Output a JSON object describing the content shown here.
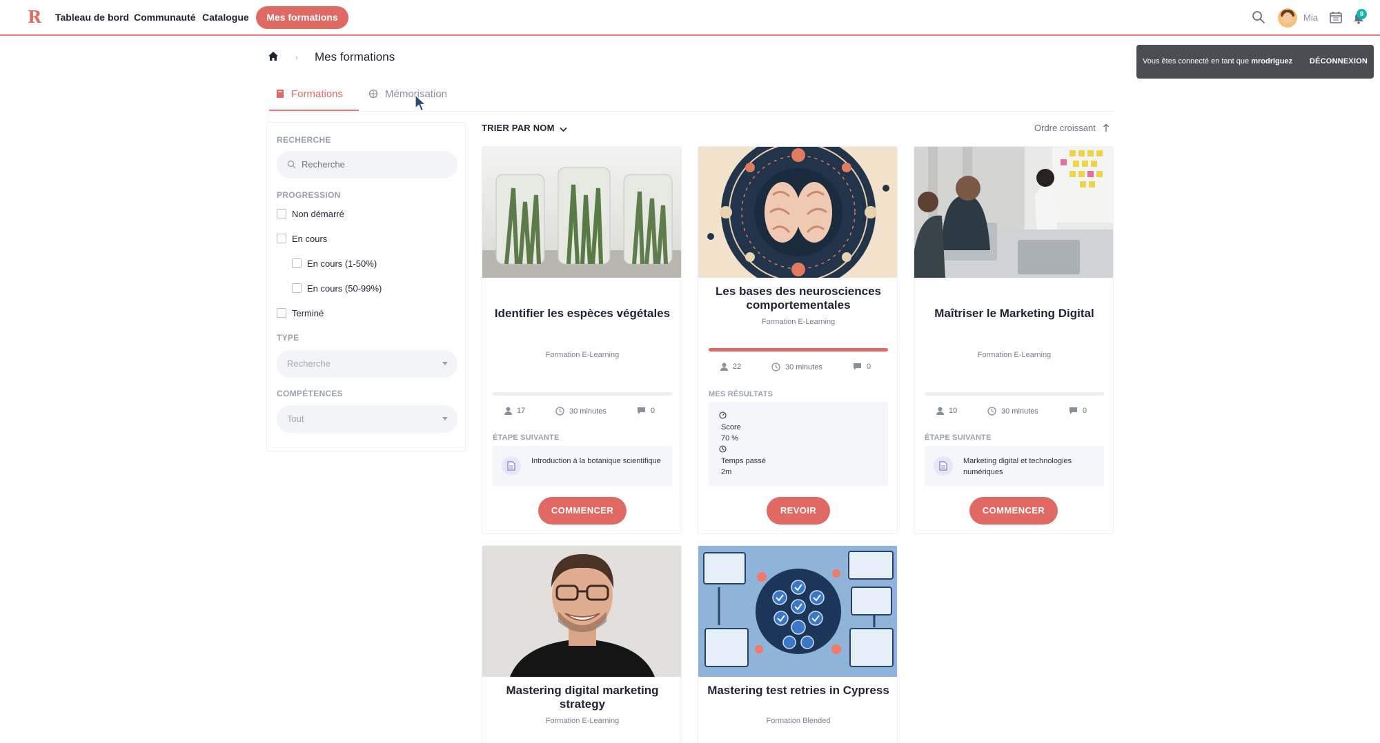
{
  "nav": {
    "logo": "R",
    "links": [
      "Tableau de bord",
      "Communauté",
      "Catalogue"
    ],
    "active": "Mes formations",
    "user_name": "Mia",
    "notification_count": "8",
    "icons": [
      "search-icon",
      "calendar-icon",
      "bell-icon"
    ]
  },
  "toast": {
    "prefix": "Vous êtes connecté en tant que",
    "username": "mrodriguez",
    "action": "DÉCONNEXION"
  },
  "breadcrumb": {
    "separator": "›",
    "title": "Mes formations"
  },
  "tabs": [
    {
      "label": "Formations",
      "active": true
    },
    {
      "label": "Mémorisation",
      "active": false
    }
  ],
  "filters": {
    "search_label": "RECHERCHE",
    "search_placeholder": "Recherche",
    "progress_label": "PROGRESSION",
    "progress_options": [
      "Non démarré",
      "En cours",
      "En cours (1-50%)",
      "En cours (50-99%)",
      "Terminé"
    ],
    "type_label": "TYPE",
    "type_value": "Recherche",
    "skills_label": "COMPÉTENCES",
    "skills_value": "Tout"
  },
  "sort": {
    "by": "TRIER PAR NOM",
    "order": "Ordre croissant"
  },
  "cards": [
    {
      "title": "Identifier les espèces végétales",
      "type": "Formation E-Learning",
      "progress": 0,
      "learners": "17",
      "duration": "30 minutes",
      "comments": "0",
      "next_label": "ÉTAPE SUIVANTE",
      "next_step": "Introduction à la botanique scientifique",
      "button": "COMMENCER"
    },
    {
      "title": "Les bases des neurosciences comportementales",
      "type": "Formation E-Learning",
      "progress": 100,
      "learners": "22",
      "duration": "30 minutes",
      "comments": "0",
      "results_label": "MES RÉSULTATS",
      "score_label": "Score",
      "score_value": "70 %",
      "time_label": "Temps passé",
      "time_value": "2m",
      "button": "REVOIR"
    },
    {
      "title": "Maîtriser le Marketing Digital",
      "type": "Formation E-Learning",
      "progress": 0,
      "learners": "10",
      "duration": "30 minutes",
      "comments": "0",
      "next_label": "ÉTAPE SUIVANTE",
      "next_step": "Marketing digital et technologies numériques",
      "button": "COMMENCER"
    },
    {
      "title": "Mastering digital marketing strategy",
      "type": "Formation E-Learning"
    },
    {
      "title": "Mastering test retries in Cypress",
      "type": "Formation Blended"
    }
  ],
  "colors": {
    "accent": "#e06a63",
    "badge": "#16b6b0",
    "toast": "#4a4d53"
  }
}
